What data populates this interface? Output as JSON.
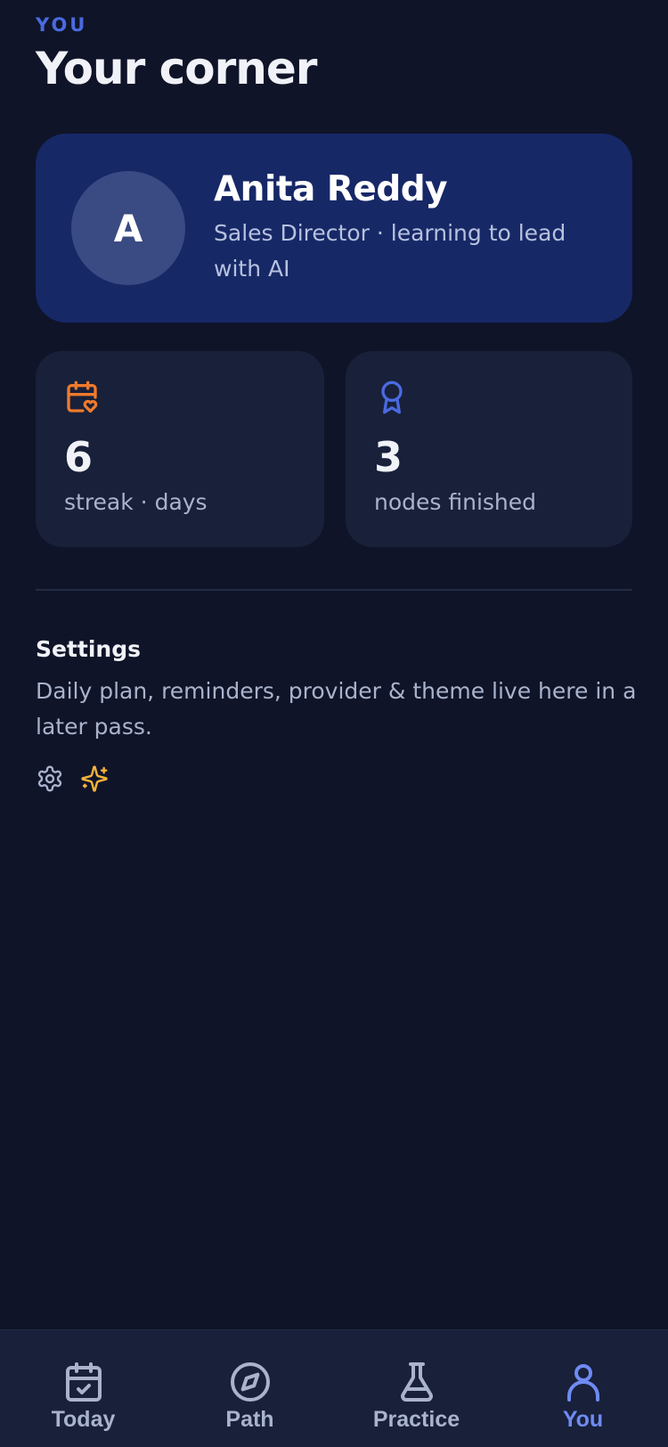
{
  "header": {
    "eyebrow": "YOU",
    "title": "Your corner"
  },
  "profile": {
    "initial": "A",
    "name": "Anita Reddy",
    "subtitle": "Sales Director · learning to lead with AI"
  },
  "stats": [
    {
      "icon": "calendar-heart-icon",
      "value": "6",
      "label": "streak · days",
      "color": "#f07a2c"
    },
    {
      "icon": "award-ribbon-icon",
      "value": "3",
      "label": "nodes finished",
      "color": "#4a6ae0"
    }
  ],
  "settings": {
    "title": "Settings",
    "description": "Daily plan, reminders, provider & theme live here in a later pass.",
    "icons": [
      "gear-icon",
      "sparkles-icon"
    ]
  },
  "tabs": [
    {
      "label": "Today",
      "icon": "calendar-check-icon",
      "active": false
    },
    {
      "label": "Path",
      "icon": "compass-icon",
      "active": false
    },
    {
      "label": "Practice",
      "icon": "flask-icon",
      "active": false
    },
    {
      "label": "You",
      "icon": "user-icon",
      "active": true
    }
  ],
  "colors": {
    "background": "#0f1428",
    "accent": "#4a6ae0",
    "profile_card": "#172867",
    "card": "#18203a",
    "streak": "#f07a2c",
    "sparkle": "#f5b33c",
    "active_tab": "#6f8bf2"
  }
}
